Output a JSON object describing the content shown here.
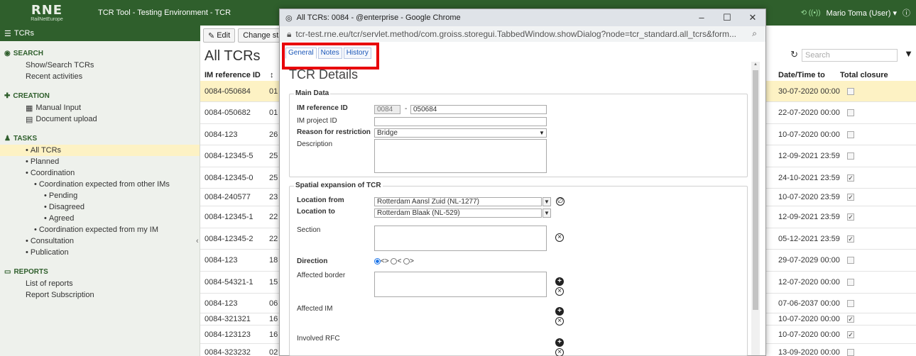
{
  "app": {
    "logo_main": "RNE",
    "logo_sub": "RailNetEurope",
    "title": "TCR Tool - Testing Environment  -  TCR",
    "user": "Mario Toma (User)"
  },
  "subbar": {
    "label": "TCRs"
  },
  "toolbar": {
    "edit": "Edit",
    "change_status": "Change status"
  },
  "sidebar": {
    "search_head": "SEARCH",
    "show_search": "Show/Search TCRs",
    "recent": "Recent activities",
    "creation_head": "CREATION",
    "manual_input": "Manual Input",
    "doc_upload": "Document upload",
    "tasks_head": "TASKS",
    "tasks": [
      "All TCRs",
      "Planned",
      "Coordination",
      "Coordination expected from other IMs",
      "Pending",
      "Disagreed",
      "Agreed",
      "Coordination expected from my IM",
      "Consultation",
      "Publication"
    ],
    "reports_head": "REPORTS",
    "list_reports": "List of reports",
    "report_sub": "Report Subscription"
  },
  "main": {
    "title": "All TCRs",
    "search_placeholder": "Search",
    "col_im_ref": "IM reference ID",
    "col_date_to": "Date/Time to",
    "col_total_closure": "Total closure",
    "rows": [
      {
        "ref": "0084-050684",
        "c2": "01",
        "date_to": "30-07-2020 00:00",
        "closure": false
      },
      {
        "ref": "0084-050682",
        "c2": "01",
        "date_to": "22-07-2020 00:00",
        "closure": false
      },
      {
        "ref": "0084-123",
        "c2": "26",
        "date_to": "10-07-2020 00:00",
        "closure": false
      },
      {
        "ref": "0084-12345-5",
        "c2": "25",
        "date_to": "12-09-2021 23:59",
        "closure": false
      },
      {
        "ref": "0084-12345-0",
        "c2": "25",
        "date_to": "24-10-2021 23:59",
        "closure": true
      },
      {
        "ref": "0084-240577",
        "c2": "23",
        "date_to": "10-07-2020 23:59",
        "closure": true
      },
      {
        "ref": "0084-12345-1",
        "c2": "22",
        "date_to": "12-09-2021 23:59",
        "closure": true
      },
      {
        "ref": "0084-12345-2",
        "c2": "22",
        "date_to": "05-12-2021 23:59",
        "closure": true
      },
      {
        "ref": "0084-123",
        "c2": "18",
        "date_to": "29-07-2029 00:00",
        "closure": false
      },
      {
        "ref": "0084-54321-1",
        "c2": "15",
        "date_to": "12-07-2020 00:00",
        "closure": false
      },
      {
        "ref": "0084-123",
        "c2": "06",
        "date_to": "07-06-2037 00:00",
        "closure": false
      },
      {
        "ref": "0084-321321",
        "c2": "16",
        "date_to": "10-07-2020 00:00",
        "closure": true
      },
      {
        "ref": "0084-123123",
        "c2": "16",
        "date_to": "10-07-2020 00:00",
        "closure": true
      },
      {
        "ref": "0084-323232",
        "c2": "02",
        "date_to": "13-09-2020 00:00",
        "closure": false
      }
    ]
  },
  "popup": {
    "title": "All TCRs: 0084 - @enterprise - Google Chrome",
    "url": "tcr-test.rne.eu/tcr/servlet.method/com.groiss.storegui.TabbedWindow.showDialog?node=tcr_standard.all_tcrs&form...",
    "tabs": [
      "General",
      "Notes",
      "History"
    ],
    "heading": "TCR Details",
    "main_data_legend": "Main Data",
    "im_ref_label": "IM reference ID",
    "im_ref_prefix": "0084",
    "im_ref_value": "050684",
    "im_project_label": "IM project ID",
    "reason_label": "Reason for restriction",
    "reason_value": "Bridge",
    "description_label": "Description",
    "spatial_legend": "Spatial expansion of TCR",
    "location_from_label": "Location from",
    "location_from_value": "Rotterdam Aansl Zuid (NL-1277)",
    "location_to_label": "Location to",
    "location_to_value": "Rotterdam Blaak (NL-529)",
    "section_label": "Section",
    "direction_label": "Direction",
    "dir_both": "<>",
    "dir_back": "<",
    "dir_fwd": ">",
    "affected_border_label": "Affected border",
    "affected_im_label": "Affected IM",
    "involved_rfc_label": "Involved RFC"
  },
  "colors": {
    "brand_green": "#2f5f2c",
    "selection": "#fdf2c4",
    "highlight_red": "#e8000b",
    "tab_blue": "#1a56b8"
  }
}
